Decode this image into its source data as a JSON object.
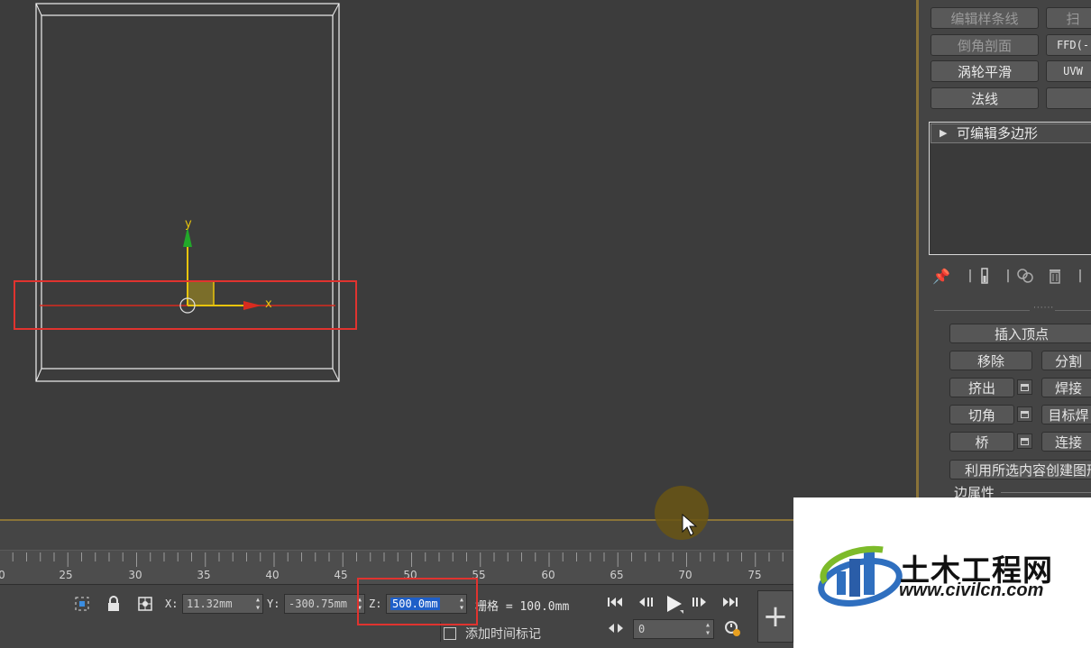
{
  "scene": {
    "axis_y_label": "y",
    "axis_x_label": "x"
  },
  "timeline": {
    "ticks": [
      "0",
      "25",
      "30",
      "35",
      "40",
      "45",
      "50",
      "55",
      "60",
      "65",
      "70",
      "75"
    ]
  },
  "statusbar": {
    "x_label": "X:",
    "x_value": "11.32mm",
    "y_label": "Y:",
    "y_value": "-300.75mm",
    "z_label": "Z:",
    "z_value": "500.0mm",
    "grid_text": "栅格 = 100.0mm",
    "add_time_tag": "添加时间标记",
    "frame_value": "0"
  },
  "panel": {
    "modifier_buttons": [
      "编辑样条线",
      "扫",
      "倒角剖面",
      "FFD(-",
      "涡轮平滑",
      "UVW",
      "法线",
      ""
    ],
    "stack_item": "可编辑多边形",
    "edit_edges": {
      "insert_vertex": "插入顶点",
      "remove": "移除",
      "split": "分割",
      "extrude": "挤出",
      "weld": "焊接",
      "chamfer": "切角",
      "target_weld": "目标焊",
      "bridge": "桥",
      "connect": "连接",
      "create_shape": "利用所选内容创建图形"
    },
    "rollout_title": "边属性"
  },
  "watermark": {
    "title": "土木工程网",
    "url": "www.civilcn.com"
  },
  "colors": {
    "x_axis": "#d82b1f",
    "y_axis": "#22a82a",
    "gizmo_yellow": "#e8c40c",
    "highlight_red": "#e0332f",
    "viewport_border": "#8a7338",
    "selection_blue": "#1f5fc8"
  }
}
